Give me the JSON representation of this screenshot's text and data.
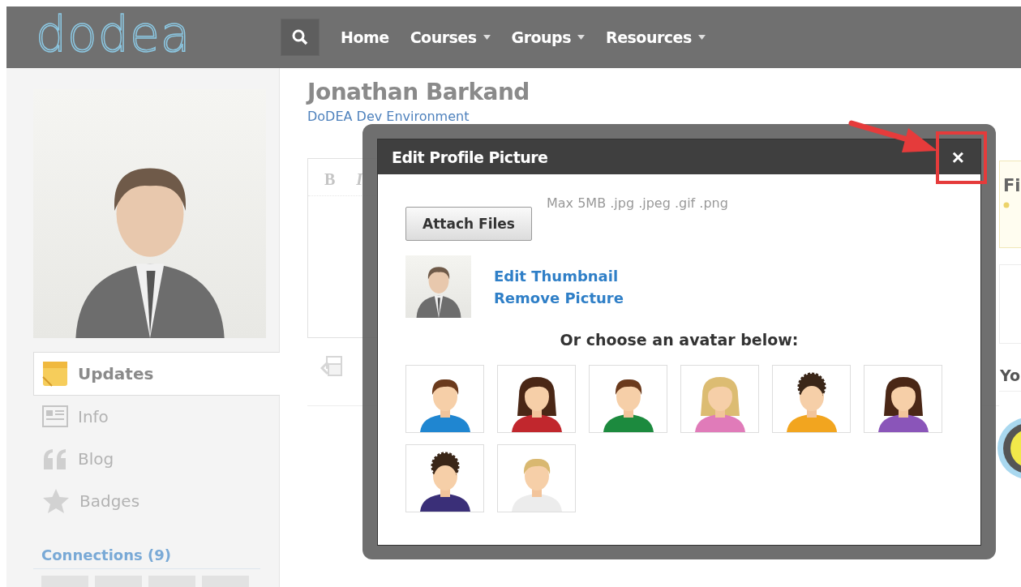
{
  "header": {
    "logo": "dodea",
    "nav": [
      {
        "label": "Home",
        "dropdown": false
      },
      {
        "label": "Courses",
        "dropdown": true
      },
      {
        "label": "Groups",
        "dropdown": true
      },
      {
        "label": "Resources",
        "dropdown": true
      }
    ]
  },
  "profile": {
    "name": "Jonathan Barkand",
    "network": "DoDEA Dev Environment"
  },
  "sidebar": {
    "items": [
      {
        "label": "Updates",
        "kind": "note",
        "selected": true
      },
      {
        "label": "Info",
        "kind": "card",
        "selected": false
      },
      {
        "label": "Blog",
        "kind": "quote",
        "selected": false
      },
      {
        "label": "Badges",
        "kind": "star",
        "selected": false
      }
    ],
    "connections": "Connections (9)"
  },
  "editor": {
    "toolbar": [
      "B",
      "I"
    ]
  },
  "right_column": {
    "card_title": "Fi",
    "section_title": "Yo"
  },
  "dialog": {
    "title": "Edit Profile Picture",
    "close": "×",
    "hint": "Max 5MB .jpg .jpeg .gif .png",
    "attach_button": "Attach Files",
    "links": [
      "Edit Thumbnail",
      "Remove Picture"
    ],
    "avatar_prompt": "Or choose an avatar below:",
    "avatars": [
      {
        "kind": "man",
        "color": "#1f86d1"
      },
      {
        "kind": "woman",
        "color": "#c1272d"
      },
      {
        "kind": "man",
        "color": "#1c8a3e"
      },
      {
        "kind": "woman-blond",
        "color": "#e07bb9"
      },
      {
        "kind": "man-curly",
        "color": "#f2a51f"
      },
      {
        "kind": "woman",
        "color": "#8a55b9"
      },
      {
        "kind": "man-curly",
        "color": "#3a2f78"
      },
      {
        "kind": "man-blond",
        "color": "#ececec"
      }
    ]
  }
}
